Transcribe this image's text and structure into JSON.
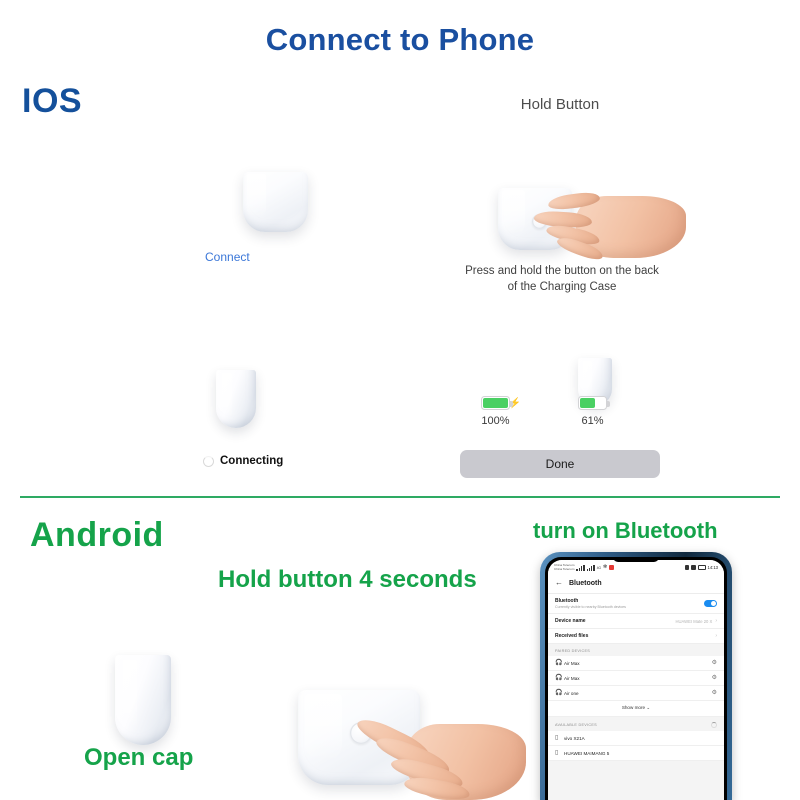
{
  "colors": {
    "title_blue": "#1a4fa0",
    "ios_blue": "#14509b",
    "android_green": "#15a34a",
    "divider_green": "#2eaa63",
    "link_blue": "#3b77d8",
    "battery_green": "#4ad063",
    "toggle_blue": "#1a8cf0"
  },
  "header": {
    "title": "Connect to Phone"
  },
  "ios": {
    "label": "IOS",
    "hold_button_label": "Hold Button",
    "connect_link": "Connect",
    "connecting_label": "Connecting",
    "press_hold_instruction": "Press and hold the button on the back of the Charging Case",
    "batteries": [
      {
        "label": "100%",
        "percent": 100,
        "charging": true
      },
      {
        "label": "61%",
        "percent": 61,
        "charging": false
      }
    ],
    "done_label": "Done"
  },
  "android": {
    "label": "Android",
    "hold_button_text": "Hold button 4 seconds",
    "turn_on_bluetooth_text": "turn on Bluetooth",
    "open_cap_text": "Open cap"
  },
  "phone": {
    "status_bar": {
      "carrier_line1": "China Telecom",
      "carrier_line2": "China Telecom",
      "network": "4G",
      "time": "14:13"
    },
    "app_bar": {
      "back_icon": "back-arrow-icon",
      "title": "Bluetooth"
    },
    "rows": [
      {
        "title": "Bluetooth",
        "subtitle": "Currently visible to nearby Bluetooth devices",
        "control": "toggle",
        "toggle_on": true
      },
      {
        "title": "Device name",
        "value": "HUAWEI Mate 20 X",
        "control": "chevron"
      },
      {
        "title": "Received files",
        "value": "",
        "control": "chevron"
      }
    ],
    "paired_section": {
      "header": "PAIRED DEVICES",
      "devices": [
        {
          "name": "Air Max",
          "icon": "headphones-icon",
          "action": "gear-icon"
        },
        {
          "name": "Air Max",
          "icon": "headphones-icon",
          "action": "gear-icon"
        },
        {
          "name": "Air one",
          "icon": "headphones-icon",
          "action": "gear-icon"
        }
      ],
      "show_more": "Show more"
    },
    "available_section": {
      "header": "AVAILABLE DEVICES",
      "devices": [
        {
          "name": "vivo X21A",
          "icon": "phone-icon"
        },
        {
          "name": "HUAWEI MAIMANG 5",
          "icon": "phone-icon"
        }
      ]
    }
  }
}
